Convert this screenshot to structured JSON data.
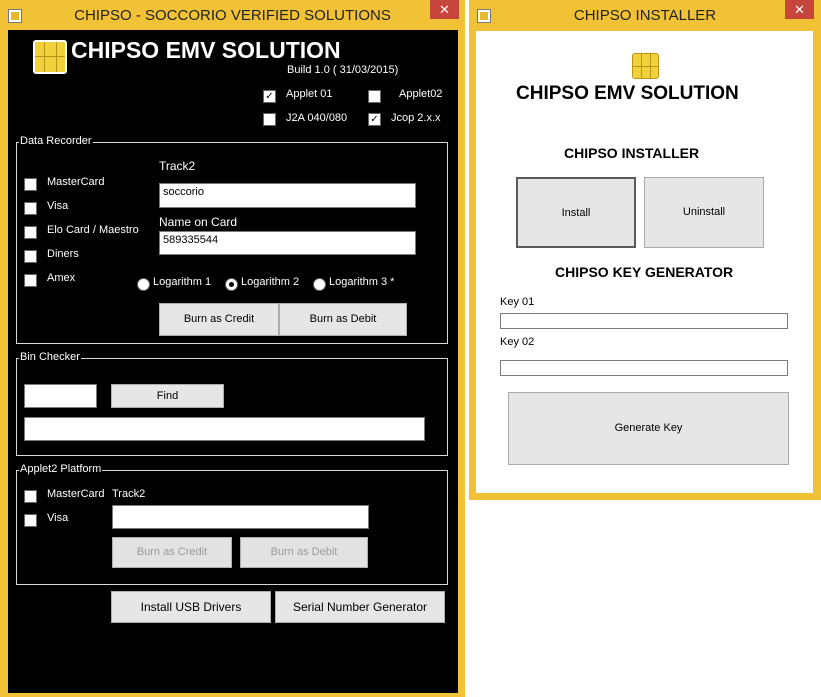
{
  "left_window": {
    "title": "CHIPSO - SOCCORIO VERIFIED SOLUTIONS",
    "close_glyph": "✕",
    "app_title": "CHIPSO EMV  SOLUTION",
    "build": "Build 1.0 ( 31/03/2015)",
    "applets": [
      {
        "label": "Applet 01",
        "checked": true
      },
      {
        "label": "Applet02",
        "checked": false
      },
      {
        "label": "J2A 040/080",
        "checked": false
      },
      {
        "label": "Jcop 2.x.x",
        "checked": true
      }
    ],
    "data_recorder": {
      "title": "Data Recorder",
      "cards": [
        {
          "label": "MasterCard",
          "checked": false
        },
        {
          "label": "Visa",
          "checked": false
        },
        {
          "label": "Elo Card / Maestro",
          "checked": false
        },
        {
          "label": "Diners",
          "checked": false
        },
        {
          "label": "Amex",
          "checked": false
        }
      ],
      "track2_label": "Track2",
      "track2_value": "soccorio",
      "name_label": "Name on Card",
      "name_value": "589335544",
      "logarithms": [
        {
          "label": "Logarithm 1",
          "selected": false
        },
        {
          "label": "Logarithm 2",
          "selected": true
        },
        {
          "label": "Logarithm 3 *",
          "selected": false
        }
      ],
      "burn_credit": "Burn as Credit",
      "burn_debit": "Burn as Debit"
    },
    "bin_checker": {
      "title": "Bin Checker",
      "input_value": "",
      "find_label": "Find",
      "result_value": ""
    },
    "applet2_platform": {
      "title": "Applet2 Platform",
      "cards": [
        {
          "label": "MasterCard",
          "checked": false
        },
        {
          "label": "Visa",
          "checked": false
        }
      ],
      "track2_label": "Track2",
      "track2_value": "",
      "burn_credit": "Burn as Credit",
      "burn_debit": "Burn as Debit"
    },
    "install_usb": "Install USB Drivers",
    "serial_gen": "Serial Number Generator"
  },
  "right_window": {
    "title": "CHIPSO INSTALLER",
    "close_glyph": "✕",
    "app_title": "CHIPSO EMV SOLUTION",
    "installer_heading": "CHIPSO INSTALLER",
    "install_label": "Install",
    "uninstall_label": "Uninstall",
    "keygen_heading": "CHIPSO KEY GENERATOR",
    "key01_label": "Key 01",
    "key01_value": "",
    "key02_label": "Key 02",
    "key02_value": "",
    "generate_label": "Generate Key"
  },
  "colors": {
    "frame": "#f2c236",
    "close_button": "#c7463b",
    "dark_client": "#000000",
    "light_client": "#ffffff"
  }
}
